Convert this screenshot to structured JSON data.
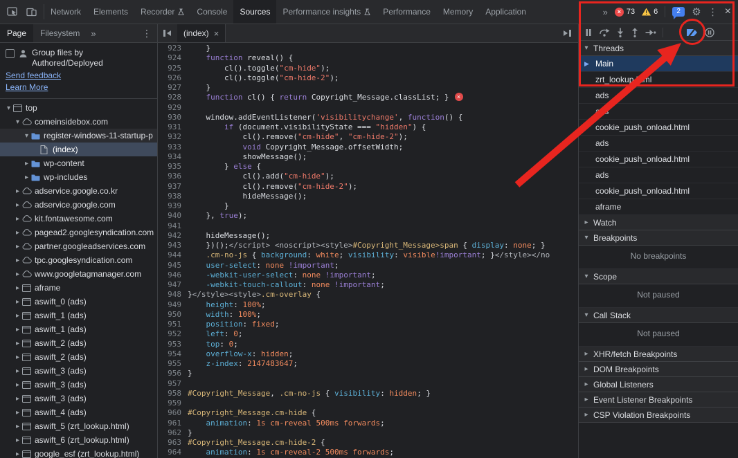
{
  "colors": {
    "annotation": "#e8251f",
    "accent_blue": "#8ab4f8",
    "error_red": "#ee4a4a",
    "warning_yellow": "#f6c344",
    "folder_blue": "#6493d6",
    "selection": "#3f4a5c",
    "thread_selection": "#1f3a5e"
  },
  "toolbar": {
    "tabs": [
      {
        "label": "Network"
      },
      {
        "label": "Elements"
      },
      {
        "label": "Recorder",
        "experiment": true
      },
      {
        "label": "Console"
      },
      {
        "label": "Sources",
        "active": true
      },
      {
        "label": "Performance insights",
        "experiment": true
      },
      {
        "label": "Performance"
      },
      {
        "label": "Memory"
      },
      {
        "label": "Application"
      }
    ],
    "more_tabs": "»",
    "error_count": "73",
    "warning_count": "6",
    "message_count": "2"
  },
  "navigator": {
    "tabs": [
      {
        "label": "Page",
        "active": true
      },
      {
        "label": "Filesystem"
      }
    ],
    "more": "»",
    "group_label_line1": "Group files by",
    "group_label_line2": "Authored/Deployed",
    "send_feedback": "Send feedback",
    "learn_more": "Learn More",
    "tree": [
      {
        "label": "top",
        "depth": 0,
        "icon": "frame",
        "exp": "open"
      },
      {
        "label": "comeinsidebox.com",
        "depth": 1,
        "icon": "cloud",
        "exp": "open"
      },
      {
        "label": "register-windows-11-startup-p",
        "depth": 2,
        "icon": "folder",
        "exp": "open",
        "hover": true
      },
      {
        "label": "(index)",
        "depth": 3,
        "icon": "file",
        "selected": true
      },
      {
        "label": "wp-content",
        "depth": 2,
        "icon": "folder",
        "exp": "closed"
      },
      {
        "label": "wp-includes",
        "depth": 2,
        "icon": "folder",
        "exp": "closed"
      },
      {
        "label": "adservice.google.co.kr",
        "depth": 1,
        "icon": "cloud",
        "exp": "closed"
      },
      {
        "label": "adservice.google.com",
        "depth": 1,
        "icon": "cloud",
        "exp": "closed"
      },
      {
        "label": "kit.fontawesome.com",
        "depth": 1,
        "icon": "cloud",
        "exp": "closed"
      },
      {
        "label": "pagead2.googlesyndication.com",
        "depth": 1,
        "icon": "cloud",
        "exp": "closed"
      },
      {
        "label": "partner.googleadservices.com",
        "depth": 1,
        "icon": "cloud",
        "exp": "closed"
      },
      {
        "label": "tpc.googlesyndication.com",
        "depth": 1,
        "icon": "cloud",
        "exp": "closed"
      },
      {
        "label": "www.googletagmanager.com",
        "depth": 1,
        "icon": "cloud",
        "exp": "closed"
      },
      {
        "label": "aframe",
        "depth": 1,
        "icon": "frame",
        "exp": "closed"
      },
      {
        "label": "aswift_0 (ads)",
        "depth": 1,
        "icon": "frame",
        "exp": "closed"
      },
      {
        "label": "aswift_1 (ads)",
        "depth": 1,
        "icon": "frame",
        "exp": "closed"
      },
      {
        "label": "aswift_1 (ads)",
        "depth": 1,
        "icon": "frame",
        "exp": "closed"
      },
      {
        "label": "aswift_2 (ads)",
        "depth": 1,
        "icon": "frame",
        "exp": "closed"
      },
      {
        "label": "aswift_2 (ads)",
        "depth": 1,
        "icon": "frame",
        "exp": "closed"
      },
      {
        "label": "aswift_3 (ads)",
        "depth": 1,
        "icon": "frame",
        "exp": "closed"
      },
      {
        "label": "aswift_3 (ads)",
        "depth": 1,
        "icon": "frame",
        "exp": "closed"
      },
      {
        "label": "aswift_3 (ads)",
        "depth": 1,
        "icon": "frame",
        "exp": "closed"
      },
      {
        "label": "aswift_4 (ads)",
        "depth": 1,
        "icon": "frame",
        "exp": "closed"
      },
      {
        "label": "aswift_5 (zrt_lookup.html)",
        "depth": 1,
        "icon": "frame",
        "exp": "closed"
      },
      {
        "label": "aswift_6 (zrt_lookup.html)",
        "depth": 1,
        "icon": "frame",
        "exp": "closed"
      },
      {
        "label": "google_esf (zrt_lookup.html)",
        "depth": 1,
        "icon": "frame",
        "exp": "closed"
      }
    ]
  },
  "editor": {
    "tab_label": "(index)",
    "lines": [
      {
        "n": 923,
        "segs": [
          [
            "p",
            "    }"
          ]
        ]
      },
      {
        "n": 924,
        "segs": [
          [
            "p",
            "    "
          ],
          [
            "k",
            "function"
          ],
          [
            "p",
            " reveal() {"
          ]
        ]
      },
      {
        "n": 925,
        "segs": [
          [
            "p",
            "        cl().toggle("
          ],
          [
            "s",
            "\"cm-hide\""
          ],
          [
            "p",
            ");"
          ]
        ]
      },
      {
        "n": 926,
        "segs": [
          [
            "p",
            "        cl().toggle("
          ],
          [
            "s",
            "\"cm-hide-2\""
          ],
          [
            "p",
            ");"
          ]
        ]
      },
      {
        "n": 927,
        "segs": [
          [
            "p",
            "    }"
          ]
        ]
      },
      {
        "n": 928,
        "error": true,
        "segs": [
          [
            "p",
            "    "
          ],
          [
            "k",
            "function"
          ],
          [
            "p",
            " cl() { "
          ],
          [
            "k",
            "return"
          ],
          [
            "p",
            " Copyright_Message.classList; }"
          ]
        ]
      },
      {
        "n": 929,
        "segs": []
      },
      {
        "n": 930,
        "segs": [
          [
            "p",
            "    window.addEventListener("
          ],
          [
            "s",
            "'visibilitychange'"
          ],
          [
            "p",
            ", "
          ],
          [
            "k",
            "function"
          ],
          [
            "p",
            "() {"
          ]
        ]
      },
      {
        "n": 931,
        "segs": [
          [
            "p",
            "        "
          ],
          [
            "k",
            "if"
          ],
          [
            "p",
            " (document.visibilityState === "
          ],
          [
            "s",
            "\"hidden\""
          ],
          [
            "p",
            ") {"
          ]
        ]
      },
      {
        "n": 932,
        "segs": [
          [
            "p",
            "            cl().remove("
          ],
          [
            "s",
            "\"cm-hide\""
          ],
          [
            "p",
            ", "
          ],
          [
            "s",
            "\"cm-hide-2\""
          ],
          [
            "p",
            ");"
          ]
        ]
      },
      {
        "n": 933,
        "segs": [
          [
            "p",
            "            "
          ],
          [
            "k",
            "void"
          ],
          [
            "p",
            " Copyright_Message.offsetWidth;"
          ]
        ]
      },
      {
        "n": 934,
        "segs": [
          [
            "p",
            "            showMessage();"
          ]
        ]
      },
      {
        "n": 935,
        "segs": [
          [
            "p",
            "        } "
          ],
          [
            "k",
            "else"
          ],
          [
            "p",
            " {"
          ]
        ]
      },
      {
        "n": 936,
        "segs": [
          [
            "p",
            "            cl().add("
          ],
          [
            "s",
            "\"cm-hide\""
          ],
          [
            "p",
            ");"
          ]
        ]
      },
      {
        "n": 937,
        "segs": [
          [
            "p",
            "            cl().remove("
          ],
          [
            "s",
            "\"cm-hide-2\""
          ],
          [
            "p",
            ");"
          ]
        ]
      },
      {
        "n": 938,
        "segs": [
          [
            "p",
            "            hideMessage();"
          ]
        ]
      },
      {
        "n": 939,
        "segs": [
          [
            "p",
            "        }"
          ]
        ]
      },
      {
        "n": 940,
        "segs": [
          [
            "p",
            "    }, "
          ],
          [
            "k",
            "true"
          ],
          [
            "p",
            ");"
          ]
        ]
      },
      {
        "n": 941,
        "segs": []
      },
      {
        "n": 942,
        "segs": [
          [
            "p",
            "    hideMessage();"
          ]
        ]
      },
      {
        "n": 943,
        "segs": [
          [
            "p",
            "    })();"
          ],
          [
            "t",
            "</script>"
          ],
          [
            "p",
            " "
          ],
          [
            "t",
            "<noscript><style>"
          ],
          [
            "sel",
            "#Copyright_Message>span"
          ],
          [
            "p",
            " { "
          ],
          [
            "pr",
            "display"
          ],
          [
            "p",
            ": "
          ],
          [
            "v",
            "none"
          ],
          [
            "p",
            "; }"
          ]
        ]
      },
      {
        "n": 944,
        "segs": [
          [
            "p",
            "    "
          ],
          [
            "sel",
            ".cm-no-js"
          ],
          [
            "p",
            " { "
          ],
          [
            "pr",
            "background"
          ],
          [
            "p",
            ": "
          ],
          [
            "v",
            "white"
          ],
          [
            "p",
            "; "
          ],
          [
            "pr",
            "visibility"
          ],
          [
            "p",
            ": "
          ],
          [
            "v",
            "visible"
          ],
          [
            "k",
            "!important"
          ],
          [
            "p",
            "; }"
          ],
          [
            "t",
            "</style></no"
          ]
        ]
      },
      {
        "n": 945,
        "segs": [
          [
            "p",
            "    "
          ],
          [
            "pr",
            "user-select"
          ],
          [
            "p",
            ": "
          ],
          [
            "v",
            "none"
          ],
          [
            "p",
            " "
          ],
          [
            "k",
            "!important"
          ],
          [
            "p",
            ";"
          ]
        ]
      },
      {
        "n": 946,
        "segs": [
          [
            "p",
            "    "
          ],
          [
            "pr",
            "-webkit-user-select"
          ],
          [
            "p",
            ": "
          ],
          [
            "v",
            "none"
          ],
          [
            "p",
            " "
          ],
          [
            "k",
            "!important"
          ],
          [
            "p",
            ";"
          ]
        ]
      },
      {
        "n": 947,
        "segs": [
          [
            "p",
            "    "
          ],
          [
            "pr",
            "-webkit-touch-callout"
          ],
          [
            "p",
            ": "
          ],
          [
            "v",
            "none"
          ],
          [
            "p",
            " "
          ],
          [
            "k",
            "!important"
          ],
          [
            "p",
            ";"
          ]
        ]
      },
      {
        "n": 948,
        "segs": [
          [
            "p",
            "}"
          ],
          [
            "t",
            "</style><style>"
          ],
          [
            "sel",
            ".cm-overlay"
          ],
          [
            "p",
            " {"
          ]
        ]
      },
      {
        "n": 949,
        "segs": [
          [
            "p",
            "    "
          ],
          [
            "pr",
            "height"
          ],
          [
            "p",
            ": "
          ],
          [
            "v",
            "100%"
          ],
          [
            "p",
            ";"
          ]
        ]
      },
      {
        "n": 950,
        "segs": [
          [
            "p",
            "    "
          ],
          [
            "pr",
            "width"
          ],
          [
            "p",
            ": "
          ],
          [
            "v",
            "100%"
          ],
          [
            "p",
            ";"
          ]
        ]
      },
      {
        "n": 951,
        "segs": [
          [
            "p",
            "    "
          ],
          [
            "pr",
            "position"
          ],
          [
            "p",
            ": "
          ],
          [
            "v",
            "fixed"
          ],
          [
            "p",
            ";"
          ]
        ]
      },
      {
        "n": 952,
        "segs": [
          [
            "p",
            "    "
          ],
          [
            "pr",
            "left"
          ],
          [
            "p",
            ": "
          ],
          [
            "v",
            "0"
          ],
          [
            "p",
            ";"
          ]
        ]
      },
      {
        "n": 953,
        "segs": [
          [
            "p",
            "    "
          ],
          [
            "pr",
            "top"
          ],
          [
            "p",
            ": "
          ],
          [
            "v",
            "0"
          ],
          [
            "p",
            ";"
          ]
        ]
      },
      {
        "n": 954,
        "segs": [
          [
            "p",
            "    "
          ],
          [
            "pr",
            "overflow-x"
          ],
          [
            "p",
            ": "
          ],
          [
            "v",
            "hidden"
          ],
          [
            "p",
            ";"
          ]
        ]
      },
      {
        "n": 955,
        "segs": [
          [
            "p",
            "    "
          ],
          [
            "pr",
            "z-index"
          ],
          [
            "p",
            ": "
          ],
          [
            "v",
            "2147483647"
          ],
          [
            "p",
            ";"
          ]
        ]
      },
      {
        "n": 956,
        "segs": [
          [
            "p",
            "}"
          ]
        ]
      },
      {
        "n": 957,
        "segs": []
      },
      {
        "n": 958,
        "segs": [
          [
            "sel",
            "#Copyright_Message"
          ],
          [
            "p",
            ", "
          ],
          [
            "sel",
            ".cm-no-js"
          ],
          [
            "p",
            " { "
          ],
          [
            "pr",
            "visibility"
          ],
          [
            "p",
            ": "
          ],
          [
            "v",
            "hidden"
          ],
          [
            "p",
            "; }"
          ]
        ]
      },
      {
        "n": 959,
        "segs": []
      },
      {
        "n": 960,
        "segs": [
          [
            "sel",
            "#Copyright_Message.cm-hide"
          ],
          [
            "p",
            " {"
          ]
        ]
      },
      {
        "n": 961,
        "segs": [
          [
            "p",
            "    "
          ],
          [
            "pr",
            "animation"
          ],
          [
            "p",
            ": "
          ],
          [
            "v",
            "1s cm-reveal 500ms forwards"
          ],
          [
            "p",
            ";"
          ]
        ]
      },
      {
        "n": 962,
        "segs": [
          [
            "p",
            "}"
          ]
        ]
      },
      {
        "n": 963,
        "segs": [
          [
            "sel",
            "#Copyright_Message.cm-hide-2"
          ],
          [
            "p",
            " {"
          ]
        ]
      },
      {
        "n": 964,
        "segs": [
          [
            "p",
            "    "
          ],
          [
            "pr",
            "animation"
          ],
          [
            "p",
            ": "
          ],
          [
            "v",
            "1s cm-reveal-2 500ms forwards"
          ],
          [
            "p",
            ";"
          ]
        ]
      }
    ]
  },
  "debugger": {
    "threads_label": "Threads",
    "threads": [
      {
        "label": "Main",
        "active": true
      },
      {
        "label": "zrt_lookup.html"
      },
      {
        "label": "ads"
      },
      {
        "label": "ads"
      },
      {
        "label": "cookie_push_onload.html"
      },
      {
        "label": "ads"
      },
      {
        "label": "cookie_push_onload.html"
      },
      {
        "label": "ads"
      },
      {
        "label": "cookie_push_onload.html"
      },
      {
        "label": "aframe"
      }
    ],
    "sections": [
      {
        "label": "Watch",
        "collapsed": true
      },
      {
        "label": "Breakpoints",
        "collapsed": false,
        "content": "No breakpoints"
      },
      {
        "label": "Scope",
        "collapsed": false,
        "content": "Not paused"
      },
      {
        "label": "Call Stack",
        "collapsed": false,
        "content": "Not paused"
      },
      {
        "label": "XHR/fetch Breakpoints",
        "collapsed": true
      },
      {
        "label": "DOM Breakpoints",
        "collapsed": true
      },
      {
        "label": "Global Listeners",
        "collapsed": true
      },
      {
        "label": "Event Listener Breakpoints",
        "collapsed": true
      },
      {
        "label": "CSP Violation Breakpoints",
        "collapsed": true
      }
    ]
  }
}
